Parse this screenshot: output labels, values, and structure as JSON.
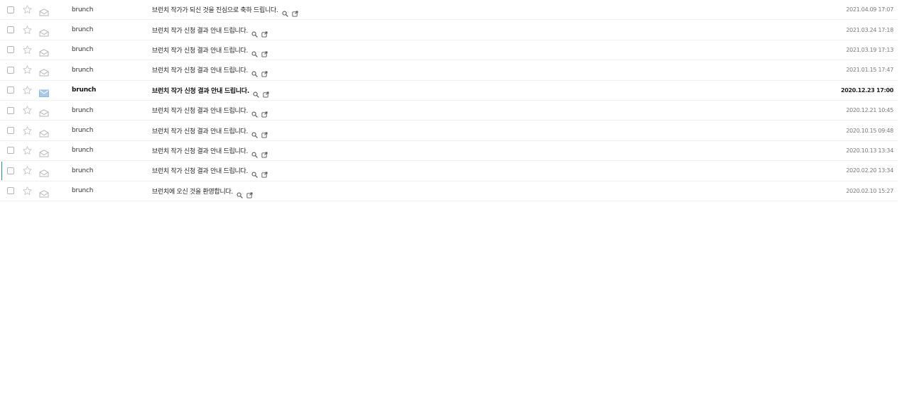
{
  "colors": {
    "accent": "#1a8fc9",
    "unread_envelope": "#a8c9ee",
    "read_envelope": "#b5b5b5",
    "star_outline": "#c4c4c4"
  },
  "icons": {
    "checkbox": "checkbox-icon",
    "star": "star-icon",
    "envelope_read": "envelope-icon",
    "envelope_unread": "envelope-unread-icon",
    "search": "search-icon",
    "open_new_window": "open-new-window-icon"
  },
  "mails": [
    {
      "sender": "brunch",
      "subject": "브런치 작가가 되신 것을 진심으로 축하 드립니다.",
      "date": "2021.04.09 17:07",
      "unread": false
    },
    {
      "sender": "brunch",
      "subject": "브런치 작가 신청 결과 안내 드립니다.",
      "date": "2021.03.24 17:18",
      "unread": false
    },
    {
      "sender": "brunch",
      "subject": "브런치 작가 신청 결과 안내 드립니다.",
      "date": "2021.03.19 17:13",
      "unread": false
    },
    {
      "sender": "brunch",
      "subject": "브런치 작가 신청 결과 안내 드립니다.",
      "date": "2021.01.15 17:47",
      "unread": false
    },
    {
      "sender": "brunch",
      "subject": "브런치 작가 신청 결과 안내 드립니다.",
      "date": "2020.12.23 17:00",
      "unread": true
    },
    {
      "sender": "brunch",
      "subject": "브런치 작가 신청 결과 안내 드립니다.",
      "date": "2020.12.21 10:45",
      "unread": false
    },
    {
      "sender": "brunch",
      "subject": "브런치 작가 신청 결과 안내 드립니다.",
      "date": "2020.10.15 09:48",
      "unread": false
    },
    {
      "sender": "brunch",
      "subject": "브런치 작가 신청 결과 안내 드립니다.",
      "date": "2020.10.13 13:34",
      "unread": false
    },
    {
      "sender": "brunch",
      "subject": "브런치 작가 신청 결과 안내 드립니다.",
      "date": "2020.02.20 13:34",
      "unread": false
    },
    {
      "sender": "brunch",
      "subject": "브런치에 오신 것을 환영합니다.",
      "date": "2020.02.10 15:27",
      "unread": false
    }
  ]
}
